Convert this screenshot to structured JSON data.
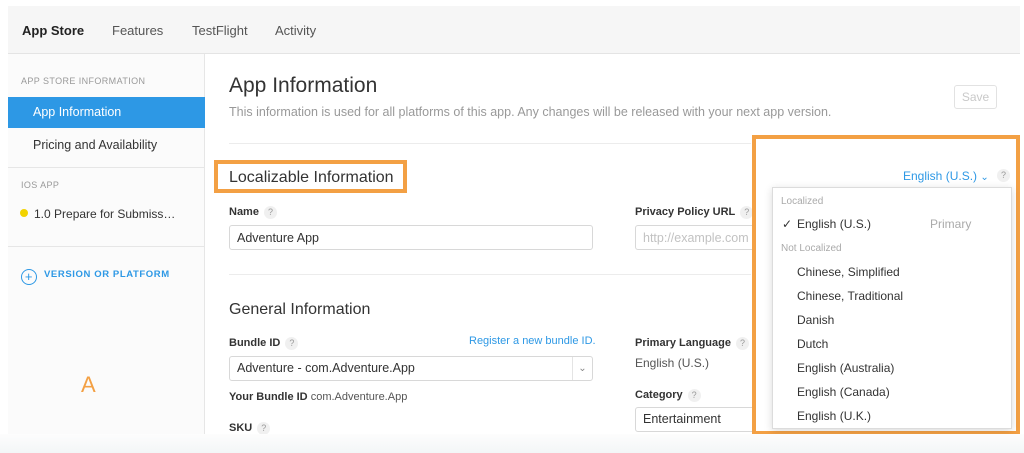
{
  "topnav": {
    "tabs": [
      {
        "label": "App Store"
      },
      {
        "label": "Features"
      },
      {
        "label": "TestFlight"
      },
      {
        "label": "Activity"
      }
    ]
  },
  "sidebar": {
    "heading_app_store": "APP STORE INFORMATION",
    "items": [
      {
        "label": "App Information"
      },
      {
        "label": "Pricing and Availability"
      }
    ],
    "heading_ios": "iOS APP",
    "version_item": "1.0 Prepare for Submiss…",
    "version_status_color": "#f2d300",
    "add_version": "VERSION OR PLATFORM",
    "watermark": "A"
  },
  "main": {
    "title": "App Information",
    "subtitle": "This information is used for all platforms of this app. Any changes will be released with your next app version.",
    "save_label": "Save",
    "localizable": {
      "title": "Localizable Information",
      "name_label": "Name",
      "name_value": "Adventure App",
      "privacy_label": "Privacy Policy URL",
      "privacy_placeholder": "http://example.com (optional)"
    },
    "general": {
      "title": "General Information",
      "bundle_label": "Bundle ID",
      "register_link": "Register a new bundle ID.",
      "bundle_value": "Adventure - com.Adventure.App",
      "your_bundle_label": "Your Bundle ID",
      "your_bundle_value": "com.Adventure.App",
      "sku_label": "SKU",
      "primary_language_label": "Primary Language",
      "primary_language_value": "English (U.S.)",
      "category_label": "Category",
      "category_value": "Entertainment"
    }
  },
  "language": {
    "current": "English (U.S.)",
    "localized_heading": "Localized",
    "localized": [
      {
        "label": "English (U.S.)",
        "tag": "Primary"
      }
    ],
    "not_localized_heading": "Not Localized",
    "not_localized": [
      {
        "label": "Chinese, Simplified"
      },
      {
        "label": "Chinese, Traditional"
      },
      {
        "label": "Danish"
      },
      {
        "label": "Dutch"
      },
      {
        "label": "English (Australia)"
      },
      {
        "label": "English (Canada)"
      },
      {
        "label": "English (U.K.)"
      }
    ]
  },
  "colors": {
    "accent": "#2d98e5",
    "highlight": "#f3a044",
    "selected_sidebar_bg": "#2d98e5"
  },
  "icons": {
    "help": "question-mark-icon",
    "add": "plus-circle-icon",
    "check": "checkmark-icon",
    "dropdown": "chevron-down-icon"
  }
}
